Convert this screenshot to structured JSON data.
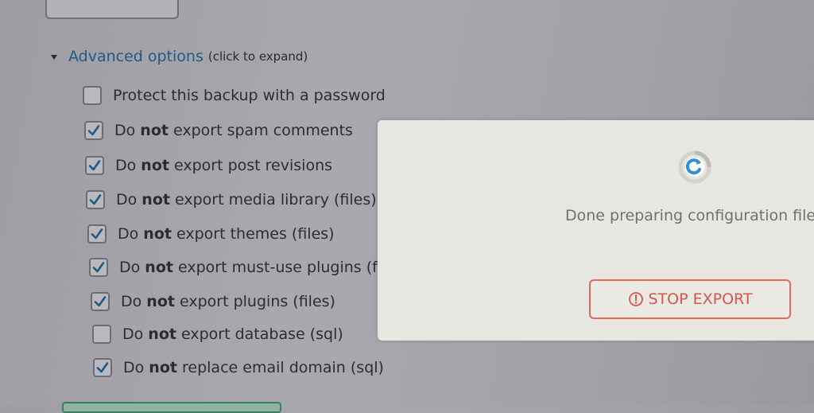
{
  "advanced": {
    "title": "Advanced options",
    "hint": "(click to expand)"
  },
  "options": [
    {
      "prefix": "Protect this backup with a password",
      "bold": "",
      "suffix": "",
      "checked": false
    },
    {
      "prefix": "Do ",
      "bold": "not",
      "suffix": " export spam comments",
      "checked": true
    },
    {
      "prefix": "Do ",
      "bold": "not",
      "suffix": " export post revisions",
      "checked": true
    },
    {
      "prefix": "Do ",
      "bold": "not",
      "suffix": " export media library (files)",
      "checked": true
    },
    {
      "prefix": "Do ",
      "bold": "not",
      "suffix": " export themes (files)",
      "checked": true
    },
    {
      "prefix": "Do ",
      "bold": "not",
      "suffix": " export must-use plugins (f",
      "checked": true
    },
    {
      "prefix": "Do ",
      "bold": "not",
      "suffix": " export plugins (files)",
      "checked": true
    },
    {
      "prefix": "Do ",
      "bold": "not",
      "suffix": " export database (sql)",
      "checked": false
    },
    {
      "prefix": "Do ",
      "bold": "not",
      "suffix": " replace email domain (sql)",
      "checked": true
    }
  ],
  "modal": {
    "status": "Done preparing configuration file",
    "stop_label": "STOP EXPORT"
  },
  "colors": {
    "accent_link": "#1f5a84",
    "spinner": "#2f8fd8",
    "stop": "#d9534a"
  }
}
